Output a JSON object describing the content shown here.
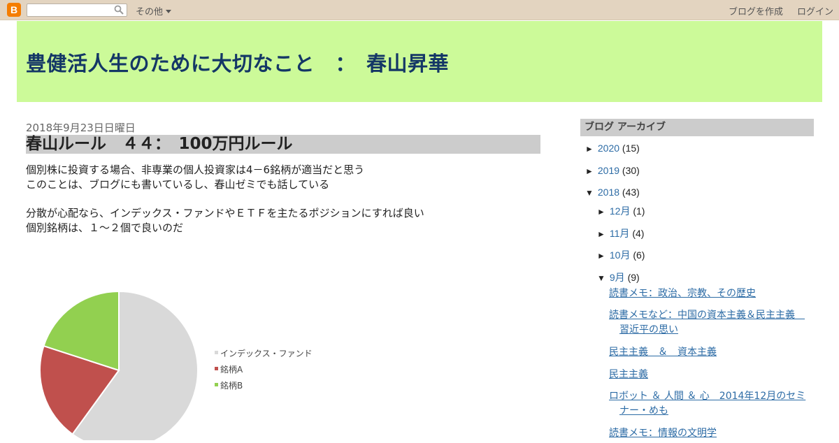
{
  "navbar": {
    "logo_letter": "B",
    "search_placeholder": "",
    "more_label": "その他",
    "create_blog_label": "ブログを作成",
    "login_label": "ログイン"
  },
  "header": {
    "title": "豊健活人生のために大切なこと　：　春山昇華"
  },
  "post": {
    "date": "2018年9月23日日曜日",
    "title": "春山ルール　４４：　100万円ルール",
    "paragraph1_line1": "個別株に投資する場合、非専業の個人投資家は4－6銘柄が適当だと思う",
    "paragraph1_line2": "このことは、ブログにも書いているし、春山ゼミでも話している",
    "paragraph2_line1": "分散が心配なら、インデックス・ファンドやＥＴＦを主たるポジションにすれば良い",
    "paragraph2_line2": "個別銘柄は、１～２個で良いのだ"
  },
  "chart_data": {
    "type": "pie",
    "series": [
      {
        "name": "インデックス・ファンド",
        "value": 60,
        "color": "#d9d9d9"
      },
      {
        "name": "銘柄A",
        "value": 20,
        "color": "#c0504d"
      },
      {
        "name": "銘柄B",
        "value": 20,
        "color": "#92d050"
      }
    ],
    "legend_position": "right"
  },
  "sidebar": {
    "heading": "ブログ アーカイブ",
    "years": [
      {
        "toggle": "►",
        "label": "2020",
        "count": "(15)"
      },
      {
        "toggle": "►",
        "label": "2019",
        "count": "(30)"
      },
      {
        "toggle": "▼",
        "label": "2018",
        "count": "(43)"
      }
    ],
    "months": [
      {
        "toggle": "►",
        "label": "12月",
        "count": "(1)"
      },
      {
        "toggle": "►",
        "label": "11月",
        "count": "(4)"
      },
      {
        "toggle": "►",
        "label": "10月",
        "count": "(6)"
      },
      {
        "toggle": "▼",
        "label": "9月",
        "count": "(9)"
      }
    ],
    "posts": [
      {
        "line1": "読書メモ：政治、宗教、その歴史",
        "line2": ""
      },
      {
        "line1": "読書メモなど：中国の資本主義＆民主主義　",
        "line2": "習近平の思い"
      },
      {
        "line1": "民主主義　＆　資本主義",
        "line2": ""
      },
      {
        "line1": "民主主義",
        "line2": ""
      },
      {
        "line1": "ロボット ＆ 人間 ＆ 心　2014年12月のセミ",
        "line2": "ナー・めも"
      },
      {
        "line1": "読書メモ：情報の文明学",
        "line2": ""
      }
    ]
  }
}
